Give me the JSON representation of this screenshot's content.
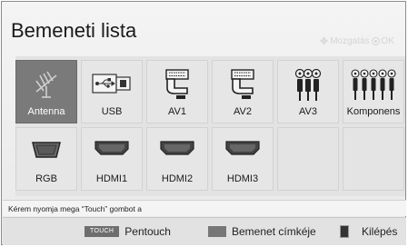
{
  "title": "Bemeneti lista",
  "hint": {
    "move_label": "Mozgatás",
    "ok_label": "OK"
  },
  "inputs": [
    {
      "label": "Antenna",
      "icon": "antenna-icon",
      "selected": true
    },
    {
      "label": "USB",
      "icon": "usb-icon",
      "selected": false
    },
    {
      "label": "AV1",
      "icon": "scart-icon",
      "selected": false
    },
    {
      "label": "AV2",
      "icon": "scart-icon",
      "selected": false
    },
    {
      "label": "AV3",
      "icon": "rca-icon",
      "selected": false
    },
    {
      "label": "Komponens",
      "icon": "component-icon",
      "selected": false
    },
    {
      "label": "RGB",
      "icon": "vga-icon",
      "selected": false
    },
    {
      "label": "HDMI1",
      "icon": "hdmi-icon",
      "selected": false
    },
    {
      "label": "HDMI2",
      "icon": "hdmi-icon",
      "selected": false
    },
    {
      "label": "HDMI3",
      "icon": "hdmi-icon",
      "selected": false
    }
  ],
  "status_text": "Kérem nyomja mega  “Touch” gombot a",
  "bottom": {
    "pentouch_key": "TOUCH",
    "pentouch_label": "Pentouch",
    "rename_label": "Bemenet címkéje",
    "exit_label": "Kilépés"
  }
}
